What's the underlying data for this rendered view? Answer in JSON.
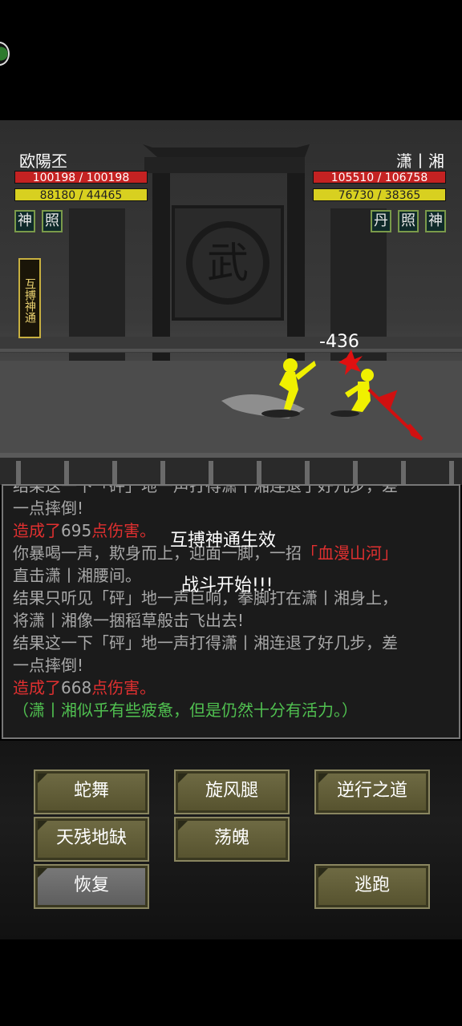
{
  "player": {
    "name": "欧陽丕",
    "hp": "100198 / 100198",
    "mp": "88180 / 44465",
    "skills": [
      "神",
      "照"
    ]
  },
  "enemy": {
    "name": "潇丨湘",
    "hp": "105510 / 106758",
    "mp": "76730 / 38365",
    "skills": [
      "丹",
      "照",
      "神"
    ]
  },
  "status_effect": "互搏神通",
  "scene": {
    "gate_sign": "武",
    "damage_float": "-436"
  },
  "log": {
    "lines": [
      [
        {
          "t": "结果这一下「砰」地一声打得潇丨湘连退了好几步，差",
          "c": "gray"
        }
      ],
      [
        {
          "t": "一点摔倒!",
          "c": "gray"
        }
      ],
      [
        {
          "t": "造成了",
          "c": "red"
        },
        {
          "t": "695",
          "c": "gray"
        },
        {
          "t": "点伤害。",
          "c": "red"
        }
      ],
      [
        {
          "t": "你暴喝一声，欺身而上，迎面一脚，一招",
          "c": "gray"
        },
        {
          "t": "「血漫山河」",
          "c": "red"
        }
      ],
      [
        {
          "t": "直击潇丨湘腰间。",
          "c": "gray"
        }
      ],
      [
        {
          "t": "结果只听见「砰」地一声巨响，拳脚打在潇丨湘身上，",
          "c": "gray"
        }
      ],
      [
        {
          "t": "将潇丨湘像一捆稻草般击飞出去!",
          "c": "gray"
        }
      ],
      [
        {
          "t": "结果这一下「砰」地一声打得潇丨湘连退了好几步，差",
          "c": "gray"
        }
      ],
      [
        {
          "t": "一点摔倒!",
          "c": "gray"
        }
      ],
      [
        {
          "t": "造成了",
          "c": "red"
        },
        {
          "t": "668",
          "c": "gray"
        },
        {
          "t": "点伤害。",
          "c": "red"
        }
      ],
      [
        {
          "t": "（潇丨湘似乎有些疲惫，但是仍然十分有活力。）",
          "c": "green"
        }
      ]
    ],
    "overlay_effect": "互搏神通生效",
    "overlay_start": "战斗开始!!!"
  },
  "actions": {
    "row1": [
      "蛇舞",
      "旋风腿",
      "逆行之道"
    ],
    "row2": [
      "天残地缺",
      "荡魄"
    ],
    "recover": "恢复",
    "flee": "逃跑"
  },
  "colors": {
    "hp": "#c42222",
    "mp": "#d8d020",
    "damage_red": "#e03030",
    "status_green": "#50c050",
    "button_olive": "#6e6a43",
    "fighter_yellow": "#f0f000"
  }
}
